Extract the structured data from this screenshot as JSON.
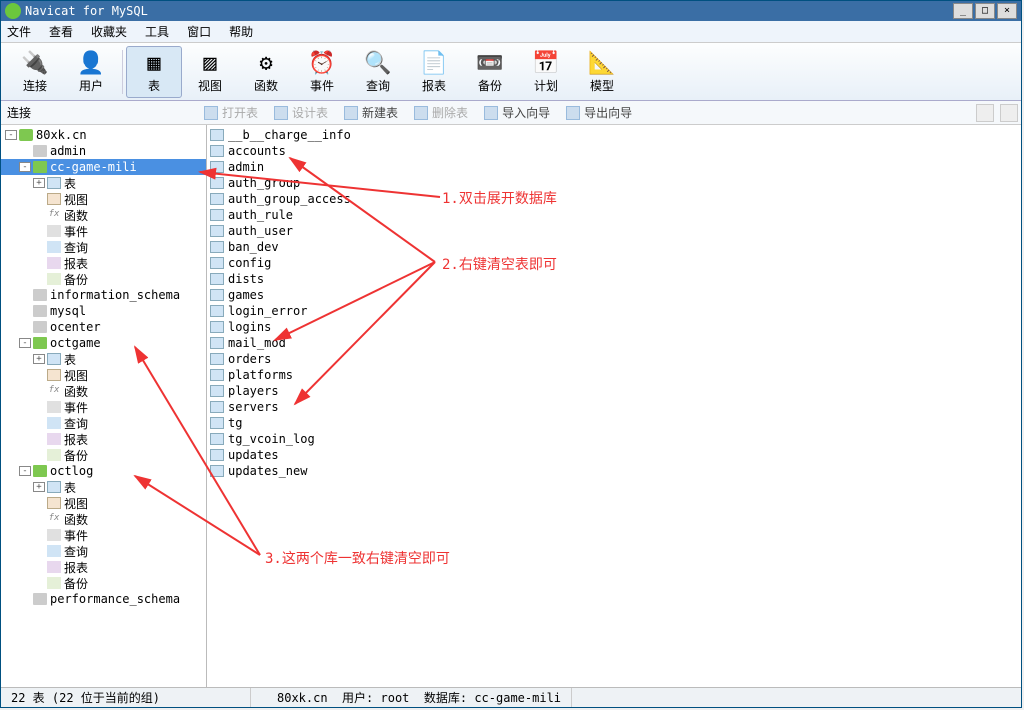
{
  "title": "Navicat for MySQL",
  "menu": [
    "文件",
    "查看",
    "收藏夹",
    "工具",
    "窗口",
    "帮助"
  ],
  "toolbar": [
    {
      "label": "连接",
      "icon": "🔌",
      "active": false
    },
    {
      "label": "用户",
      "icon": "👤",
      "active": false
    },
    {
      "label": "表",
      "icon": "▦",
      "active": true
    },
    {
      "label": "视图",
      "icon": "▨",
      "active": false
    },
    {
      "label": "函数",
      "icon": "⚙",
      "active": false
    },
    {
      "label": "事件",
      "icon": "⏰",
      "active": false
    },
    {
      "label": "查询",
      "icon": "🔍",
      "active": false
    },
    {
      "label": "报表",
      "icon": "📄",
      "active": false
    },
    {
      "label": "备份",
      "icon": "📼",
      "active": false
    },
    {
      "label": "计划",
      "icon": "📅",
      "active": false
    },
    {
      "label": "模型",
      "icon": "📐",
      "active": false
    }
  ],
  "subtoolbar": {
    "connlabel": "连接",
    "buttons": [
      {
        "label": "打开表",
        "enabled": false
      },
      {
        "label": "设计表",
        "enabled": false
      },
      {
        "label": "新建表",
        "enabled": true
      },
      {
        "label": "删除表",
        "enabled": false
      },
      {
        "label": "导入向导",
        "enabled": true
      },
      {
        "label": "导出向导",
        "enabled": true
      }
    ]
  },
  "tree": {
    "connection": "80xk.cn",
    "databases": [
      {
        "name": "admin",
        "open": false,
        "active": false
      },
      {
        "name": "cc-game-mili",
        "open": true,
        "active": true,
        "selected": true,
        "children": [
          {
            "label": "表",
            "icon": "table",
            "expandable": true
          },
          {
            "label": "视图",
            "icon": "view"
          },
          {
            "label": "函数",
            "icon": "fx"
          },
          {
            "label": "事件",
            "icon": "event"
          },
          {
            "label": "查询",
            "icon": "query"
          },
          {
            "label": "报表",
            "icon": "report"
          },
          {
            "label": "备份",
            "icon": "backup"
          }
        ]
      },
      {
        "name": "information_schema",
        "open": false,
        "active": false
      },
      {
        "name": "mysql",
        "open": false,
        "active": false
      },
      {
        "name": "ocenter",
        "open": false,
        "active": false
      },
      {
        "name": "octgame",
        "open": true,
        "active": true,
        "children": [
          {
            "label": "表",
            "icon": "table",
            "expandable": true
          },
          {
            "label": "视图",
            "icon": "view"
          },
          {
            "label": "函数",
            "icon": "fx"
          },
          {
            "label": "事件",
            "icon": "event"
          },
          {
            "label": "查询",
            "icon": "query"
          },
          {
            "label": "报表",
            "icon": "report"
          },
          {
            "label": "备份",
            "icon": "backup"
          }
        ]
      },
      {
        "name": "octlog",
        "open": true,
        "active": true,
        "children": [
          {
            "label": "表",
            "icon": "table",
            "expandable": true
          },
          {
            "label": "视图",
            "icon": "view"
          },
          {
            "label": "函数",
            "icon": "fx"
          },
          {
            "label": "事件",
            "icon": "event"
          },
          {
            "label": "查询",
            "icon": "query"
          },
          {
            "label": "报表",
            "icon": "report"
          },
          {
            "label": "备份",
            "icon": "backup"
          }
        ]
      },
      {
        "name": "performance_schema",
        "open": false,
        "active": false
      }
    ]
  },
  "tables": [
    "__b__charge__info",
    "accounts",
    "admin",
    "auth_group",
    "auth_group_access",
    "auth_rule",
    "auth_user",
    "ban_dev",
    "config",
    "dists",
    "games",
    "login_error",
    "logins",
    "mail_mod",
    "orders",
    "platforms",
    "players",
    "servers",
    "tg",
    "tg_vcoin_log",
    "updates",
    "updates_new"
  ],
  "status": {
    "left": "22 表 (22 位于当前的组)",
    "conn": "80xk.cn",
    "user_lbl": "用户:",
    "user": "root",
    "db_lbl": "数据库:",
    "db": "cc-game-mili"
  },
  "annotations": {
    "a1": "1.双击展开数据库",
    "a2": "2.右键清空表即可",
    "a3": "3.这两个库一致右键清空即可"
  }
}
